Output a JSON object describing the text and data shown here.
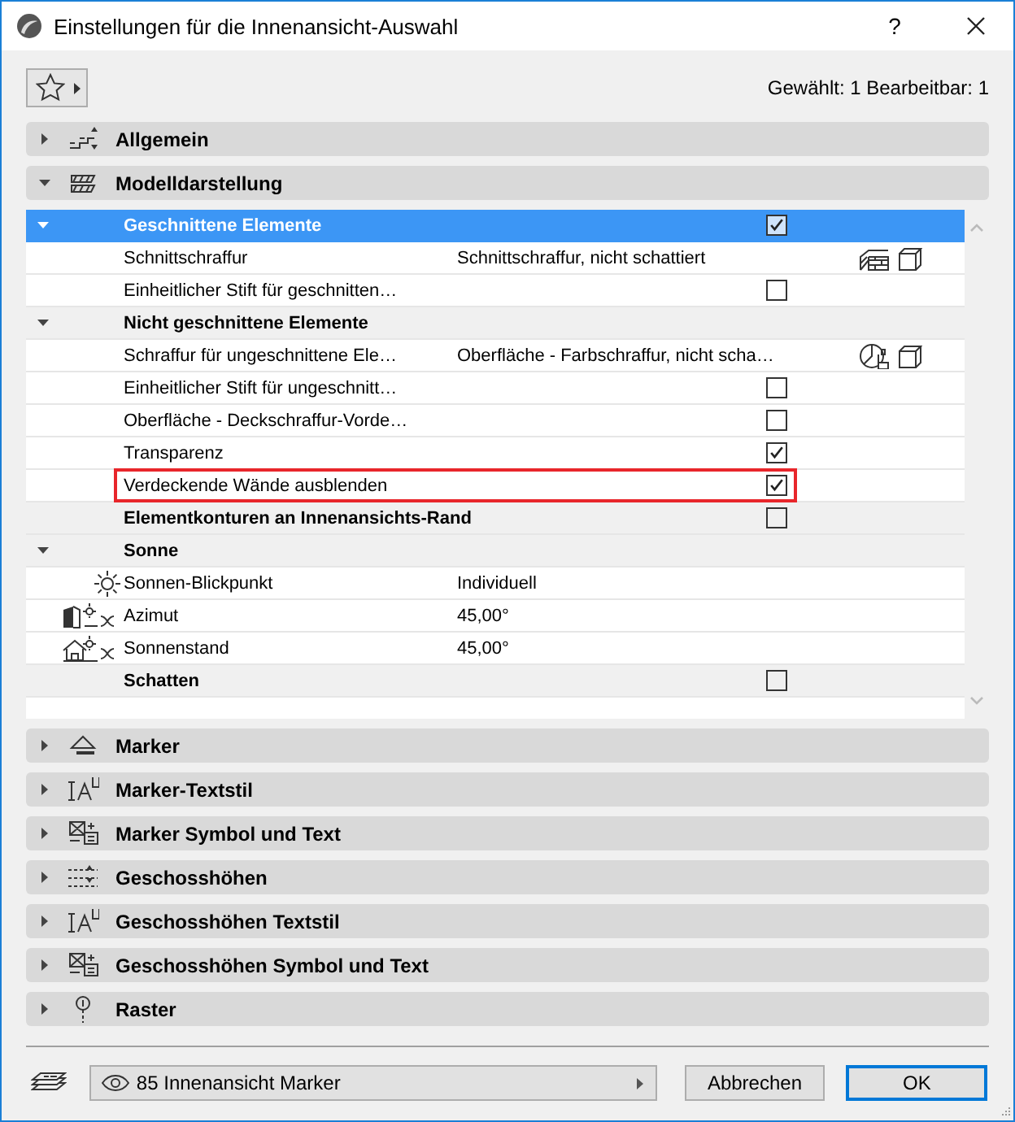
{
  "window": {
    "title": "Einstellungen für die Innenansicht-Auswahl",
    "help": "?"
  },
  "toolbar": {
    "selection_info": "Gewählt: 1 Bearbeitbar: 1"
  },
  "panels": [
    {
      "label": "Allgemein",
      "expanded": false
    },
    {
      "label": "Modelldarstellung",
      "expanded": true,
      "tree": [
        {
          "kind": "group",
          "label": "Geschnittene Elemente",
          "expanded": true,
          "selected": true,
          "highlighted": false,
          "checked": true,
          "children": [
            {
              "kind": "setting",
              "label": "Schnittschraffur",
              "value": "Schnittschraffur, nicht schattiert",
              "selected": false,
              "highlighted": false
            },
            {
              "kind": "setting",
              "label": "Einheitlicher Stift für geschnitten…",
              "selected": false,
              "highlighted": false,
              "checked": false
            }
          ]
        },
        {
          "kind": "group",
          "label": "Nicht geschnittene Elemente",
          "expanded": true,
          "selected": false,
          "highlighted": false,
          "children": [
            {
              "kind": "setting",
              "label": "Schraffur für ungeschnittene Ele…",
              "value": "Oberfläche - Farbschraffur, nicht scha…",
              "selected": false,
              "highlighted": false
            },
            {
              "kind": "setting",
              "label": "Einheitlicher Stift für ungeschnitt…",
              "selected": false,
              "highlighted": false,
              "checked": false
            },
            {
              "kind": "setting",
              "label": "Oberfläche - Deckschraffur-Vorde…",
              "selected": false,
              "highlighted": false,
              "checked": false
            },
            {
              "kind": "setting",
              "label": "Transparenz",
              "selected": false,
              "highlighted": false,
              "checked": true
            },
            {
              "kind": "setting",
              "label": "Verdeckende Wände ausblenden",
              "selected": false,
              "highlighted": true,
              "checked": true
            }
          ]
        },
        {
          "kind": "group",
          "label": "Elementkonturen an Innenansichts-Rand",
          "selected": false,
          "highlighted": false,
          "checked": false
        },
        {
          "kind": "group",
          "label": "Sonne",
          "expanded": true,
          "selected": false,
          "highlighted": false,
          "children": [
            {
              "kind": "setting",
              "label": "Sonnen-Blickpunkt",
              "value": "Individuell",
              "selected": false,
              "highlighted": false
            },
            {
              "kind": "setting",
              "label": "Azimut",
              "value": "45,00°",
              "selected": false,
              "highlighted": false
            },
            {
              "kind": "setting",
              "label": "Sonnenstand",
              "value": "45,00°",
              "selected": false,
              "highlighted": false
            }
          ]
        },
        {
          "kind": "group",
          "label": "Schatten",
          "selected": false,
          "highlighted": false,
          "checked": false
        }
      ]
    },
    {
      "label": "Marker",
      "expanded": false
    },
    {
      "label": "Marker-Textstil",
      "expanded": false
    },
    {
      "label": "Marker Symbol und Text",
      "expanded": false
    },
    {
      "label": "Geschosshöhen",
      "expanded": false
    },
    {
      "label": "Geschosshöhen Textstil",
      "expanded": false
    },
    {
      "label": "Geschosshöhen Symbol und Text",
      "expanded": false
    },
    {
      "label": "Raster",
      "expanded": false
    }
  ],
  "footer": {
    "layer_dropdown": {
      "value": "85 Innenansicht Marker"
    },
    "buttons": [
      {
        "label": "Abbrechen",
        "default": false
      },
      {
        "label": "OK",
        "default": true
      }
    ]
  }
}
